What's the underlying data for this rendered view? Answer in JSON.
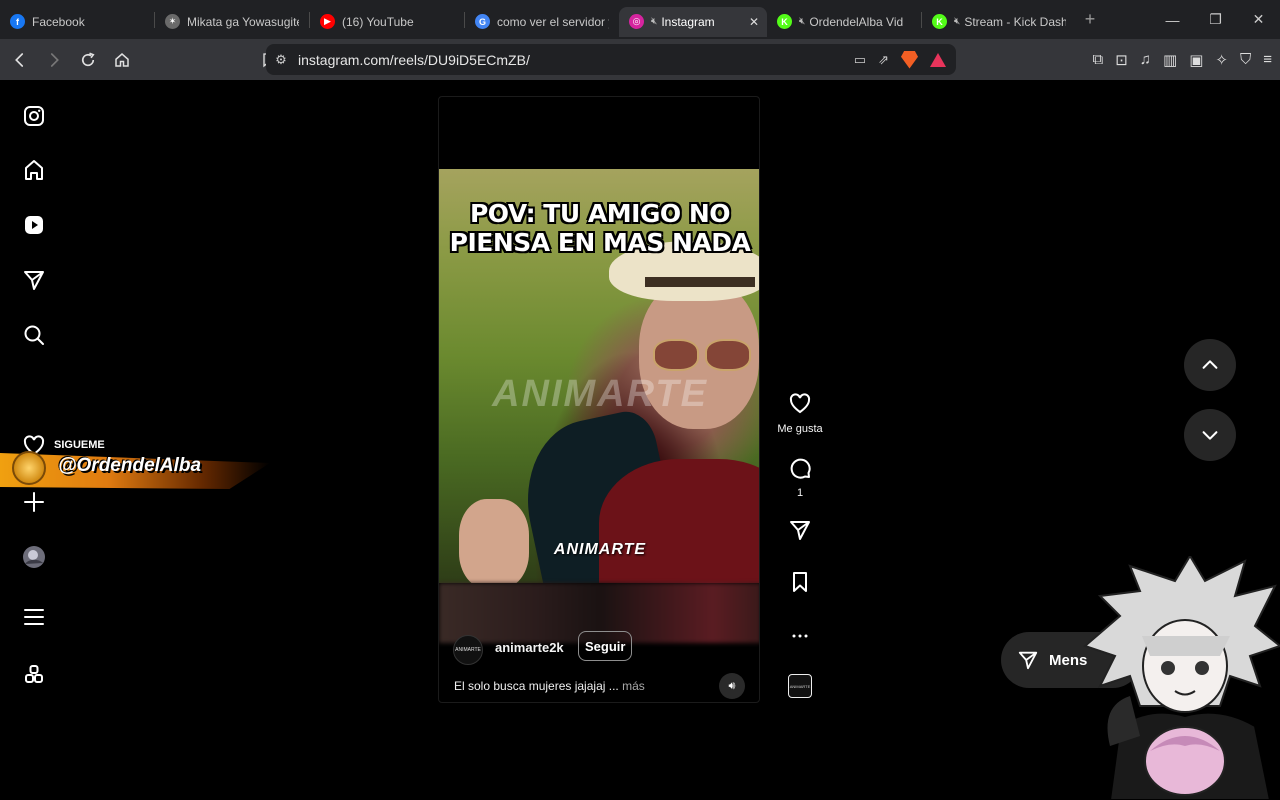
{
  "browser": {
    "tabs": [
      {
        "title": "Facebook",
        "favicon": "facebook-icon",
        "color": "#1877f2",
        "glyph": "f",
        "muted": false,
        "active": false
      },
      {
        "title": "Mikata ga Yowasugite",
        "favicon": "anime-site-icon",
        "color": "#6a6a6a",
        "glyph": "✶",
        "muted": false,
        "active": false
      },
      {
        "title": "(16) YouTube",
        "favicon": "youtube-icon",
        "color": "#ff0000",
        "glyph": "▶",
        "muted": false,
        "active": false
      },
      {
        "title": "como ver el servidor y",
        "favicon": "google-icon",
        "color": "#4285f4",
        "glyph": "G",
        "muted": false,
        "active": false
      },
      {
        "title": "Instagram",
        "favicon": "instagram-icon",
        "color": "#d6249f",
        "glyph": "◎",
        "muted": true,
        "active": true
      },
      {
        "title": "OrdendelAlba Vid",
        "favicon": "kick-icon",
        "color": "#53fc18",
        "glyph": "K",
        "muted": true,
        "active": false
      },
      {
        "title": "Stream - Kick Dash",
        "favicon": "kick-icon",
        "color": "#53fc18",
        "glyph": "K",
        "muted": true,
        "active": false
      }
    ],
    "url": "instagram.com/reels/DU9iD5ECmZB/"
  },
  "reel": {
    "overlay_text_line1": "POV: TU AMIGO NO",
    "overlay_text_line2": "PIENSA EN MAS NADA",
    "watermark": "ANIMARTE",
    "watermark_small": "ANIMARTE",
    "avatar_text": "ANIMARTE",
    "username": "animarte2k",
    "follow_label": "Seguir",
    "caption": "El solo busca mujeres jajajaj ...",
    "caption_more": "más",
    "audio_thumb_text": "ANIMARTE"
  },
  "actions": {
    "like_label": "Me gusta",
    "comment_count": "1"
  },
  "message_button": {
    "label": "Mens"
  },
  "stream_overlay": {
    "small": "SIGUEME",
    "handle": "@OrdendelAlba"
  },
  "colors": {
    "accent_active_tab": "#35363a",
    "page_bg": "#000000",
    "overlay_orange": "#f0a010"
  }
}
